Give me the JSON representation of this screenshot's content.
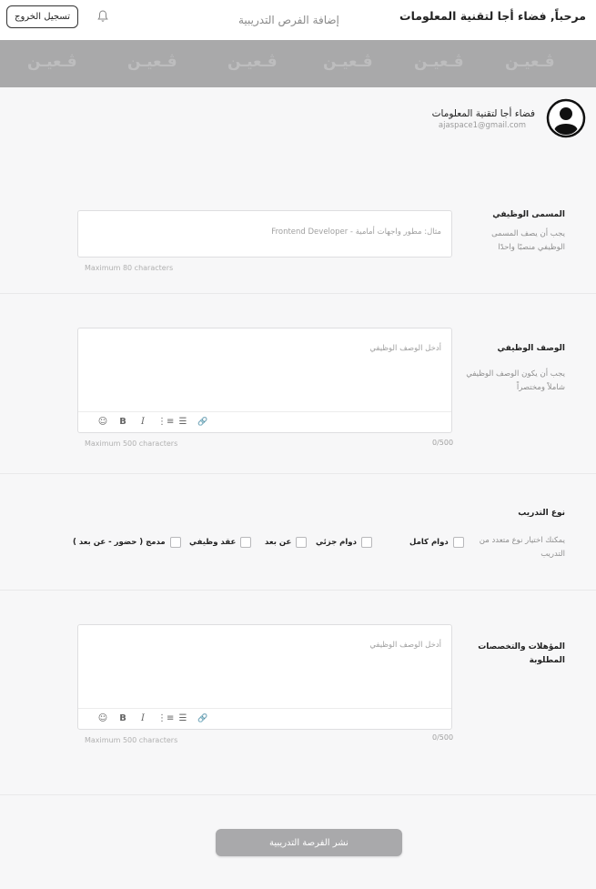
{
  "header": {
    "greeting": "مرحباً, فضاء أجا لتقنية المعلومات",
    "page_title": "إضافة الفرص التدريبية",
    "logout_label": "تسجيل الخروج"
  },
  "banner": {
    "watermark": "ڤـعيـن"
  },
  "profile": {
    "name": "فضاء أجا لتقنية المعلومات",
    "email": "ajaspace1@gmail.com"
  },
  "job_title": {
    "label": "المسمى الوظيفي",
    "hint": "يجب أن يصف المسمى الوظيفي منصبًا واحدًا",
    "placeholder": "مثال: مطور واجهات أمامية - Frontend Developer",
    "limit": "Maximum 80 characters"
  },
  "job_description": {
    "label": "الوصف الوظيفي",
    "hint": "يجب أن يكون الوصف الوظيفي شاملاً ومختصراً",
    "placeholder": "أدخل الوصف الوظيفي",
    "limit": "Maximum 500 characters",
    "counter": "0/500"
  },
  "training_type": {
    "label": "نوع التدريب",
    "hint": "يمكنك اختيار نوع متعدد من التدريب",
    "options": [
      "دوام كامل",
      "دوام جزئي",
      "عن بعد",
      "عقد وظيفي",
      "مدمج ( حضور - عن بعد )"
    ]
  },
  "qualifications": {
    "label": "المؤهلات والتخصصات المطلوبة",
    "placeholder": "أدخل الوصف الوظيفي",
    "limit": "Maximum 500 characters",
    "counter": "0/500"
  },
  "toolbar": {
    "emoji": "☺",
    "bold": "B",
    "italic": "I",
    "ordered_list": "⋮≡",
    "bullet_list": "☰",
    "link": "🔗"
  },
  "submit_label": "نشر الفرصة التدريبية"
}
